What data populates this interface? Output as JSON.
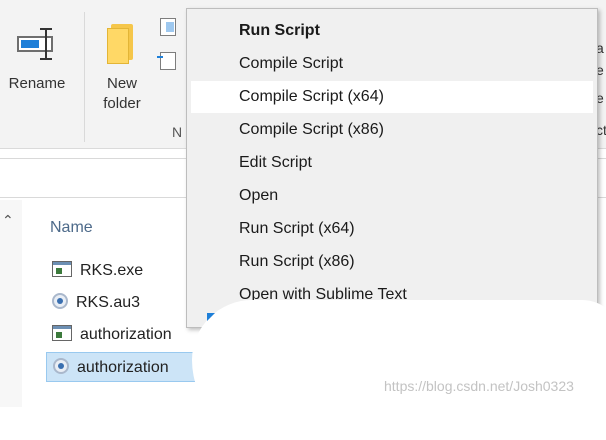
{
  "ribbon": {
    "rename_label": "Rename",
    "new_folder_label_line1": "New",
    "new_folder_label_line2": "folder",
    "group_label": "N",
    "right_edge_chars": [
      "a",
      "e",
      "e",
      "ct"
    ]
  },
  "file_list": {
    "column_name": "Name",
    "files": [
      {
        "name": "RKS.exe",
        "icon": "exe-icon"
      },
      {
        "name": "RKS.au3",
        "icon": "autoit-script-icon"
      },
      {
        "name": "authorization",
        "icon": "exe-icon"
      },
      {
        "name": "authorization",
        "icon": "autoit-script-icon",
        "selected": true
      }
    ]
  },
  "context_menu": {
    "items": [
      {
        "label": "Run Script",
        "bold": true
      },
      {
        "label": "Compile Script"
      },
      {
        "label": "Compile Script (x64)",
        "hovered": true
      },
      {
        "label": "Compile Script (x86)"
      },
      {
        "label": "Edit Script"
      },
      {
        "label": "Open"
      },
      {
        "label": "Run Script (x64)"
      },
      {
        "label": "Run Script (x86)"
      },
      {
        "label": "Open with Sublime Text"
      }
    ]
  },
  "watermark": "https://blog.csdn.net/Josh0323",
  "colors": {
    "menu_bg": "#f0f0f0",
    "menu_hover": "#ffffff",
    "selection": "#cce4f7",
    "accent": "#1e7fd8"
  }
}
